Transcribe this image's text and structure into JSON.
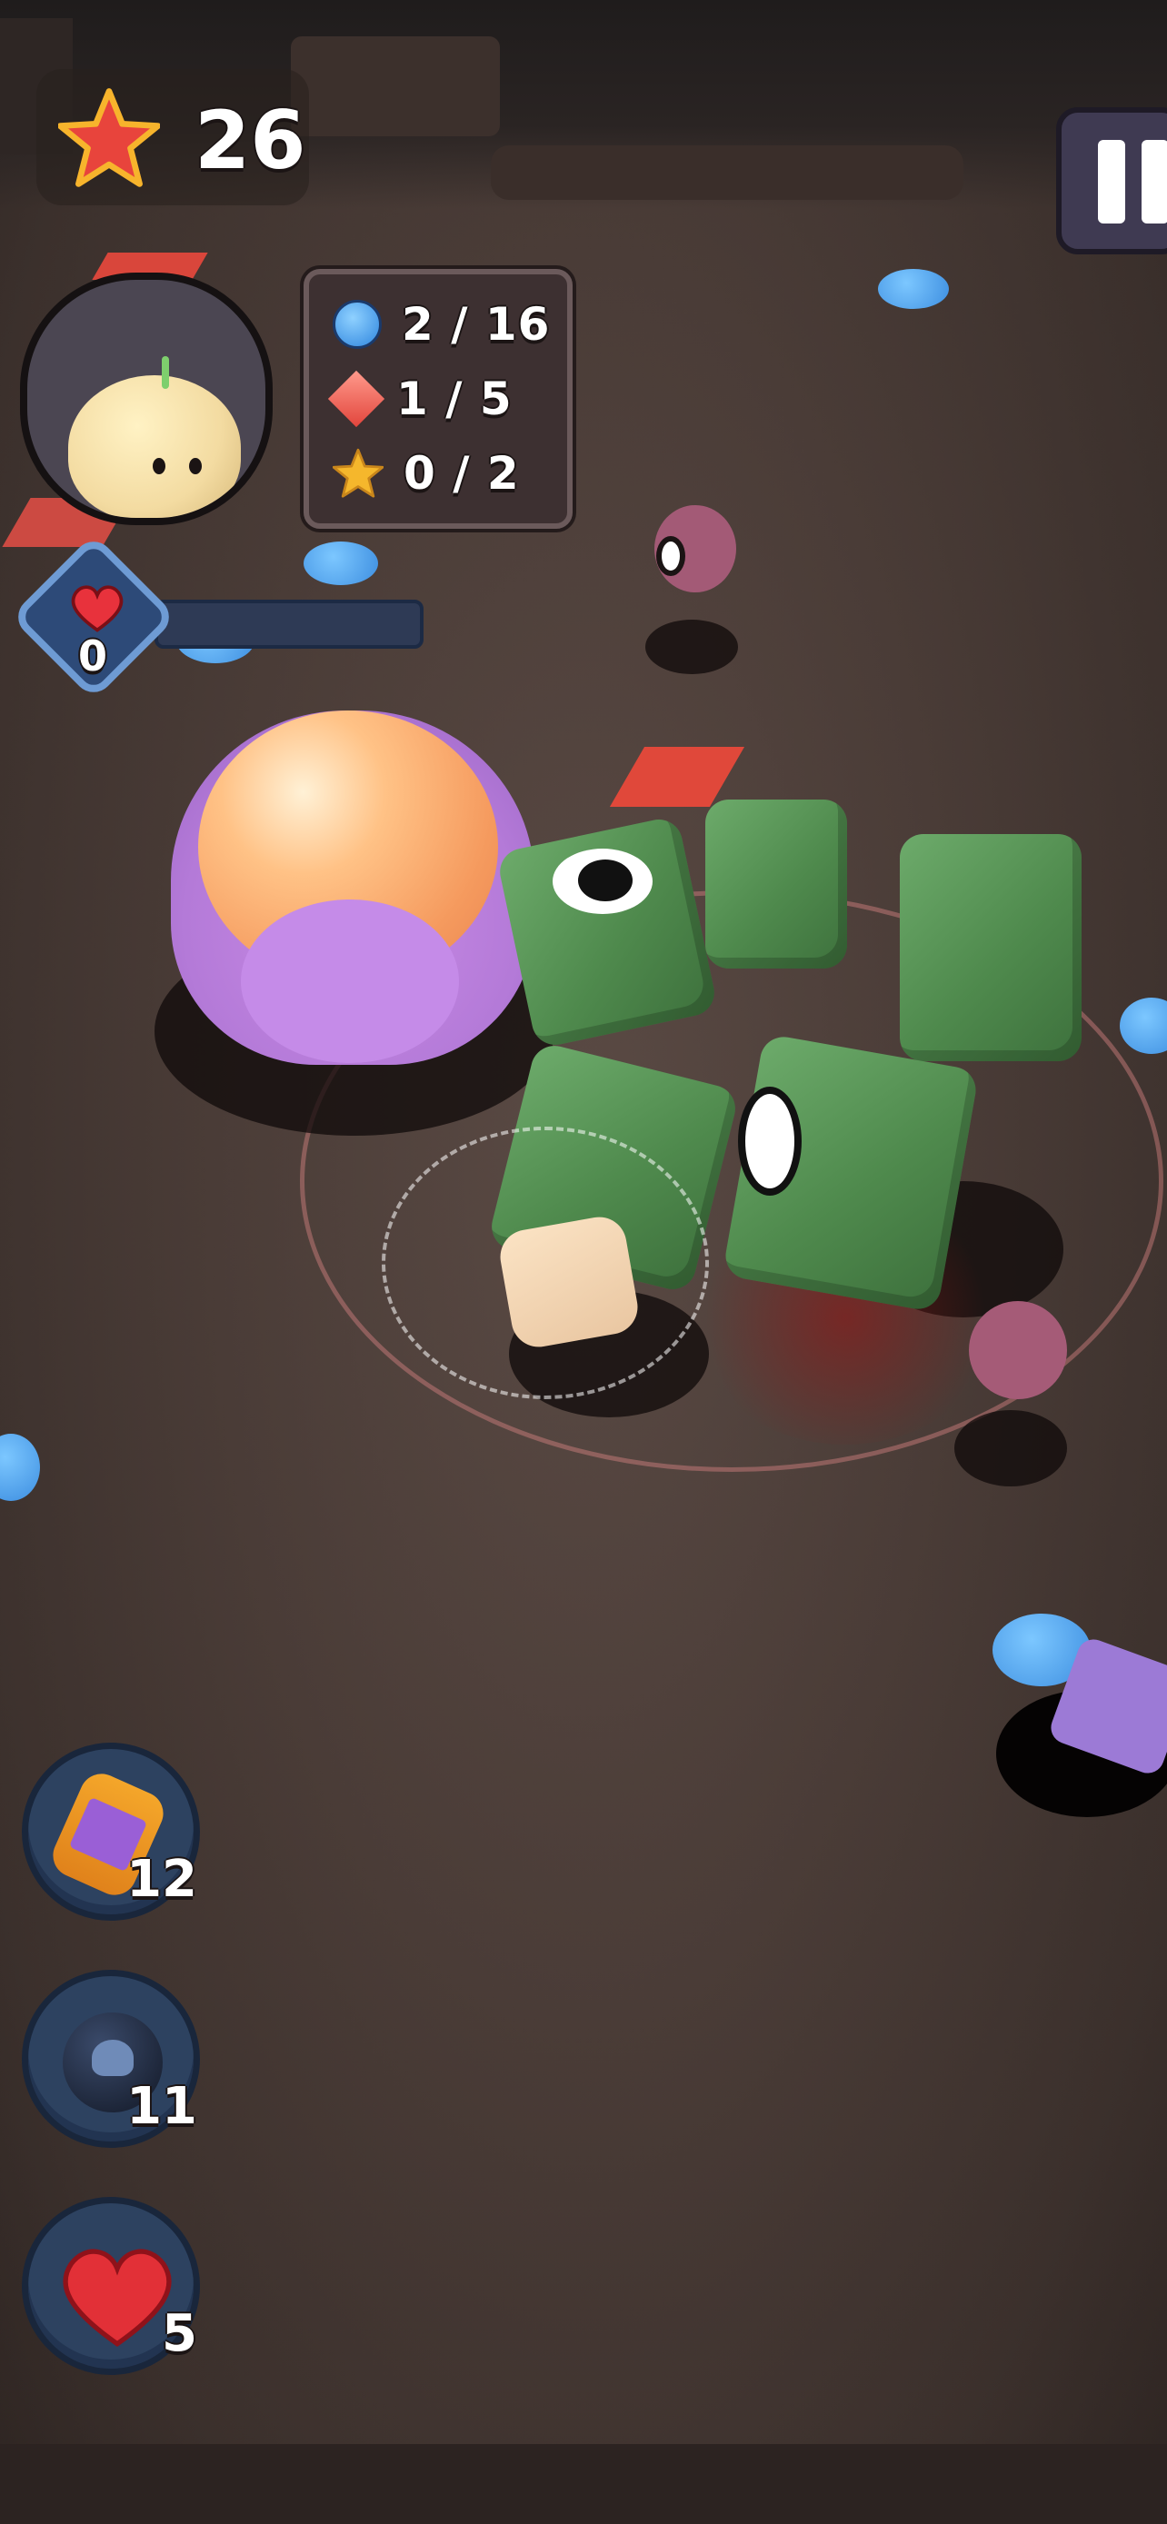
{
  "hud": {
    "score": "26",
    "score_icon": "star-icon",
    "collectibles": [
      {
        "icon": "blue-orb-icon",
        "text": "2 / 16",
        "color": "#4aa3f0"
      },
      {
        "icon": "red-gem-icon",
        "text": "1 / 5",
        "color": "#e8534a"
      },
      {
        "icon": "gold-star-icon",
        "text": "0 / 2",
        "color": "#f5b72c"
      }
    ],
    "health": {
      "value": "0",
      "bar_fill": 0.0,
      "icon": "heart-icon"
    },
    "pause_icon": "pause-icon"
  },
  "items": [
    {
      "name": "energy-canister",
      "icon": "battery-icon",
      "count": "12"
    },
    {
      "name": "skull-bomb",
      "icon": "bomb-icon",
      "count": "11"
    },
    {
      "name": "extra-heart",
      "icon": "heart-icon",
      "count": "5"
    }
  ],
  "colors": {
    "ground": "#4a3c37",
    "cube_green": "#4f8a4d",
    "orb_blue": "#4aa3f0",
    "panel": "#3d3031"
  }
}
